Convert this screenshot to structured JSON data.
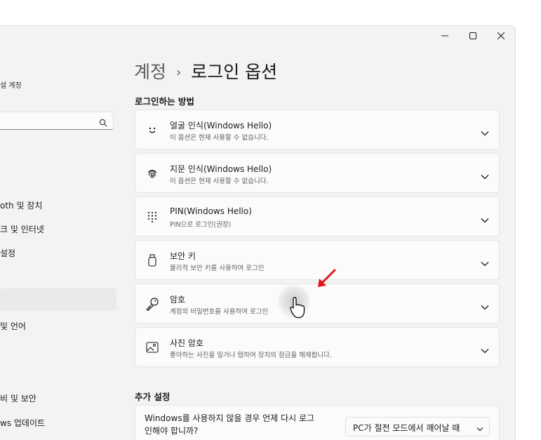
{
  "window_controls": {
    "minimize": "minimize-icon",
    "maximize": "maximize-icon",
    "close": "close-icon"
  },
  "sidebar": {
    "account_label": "설 계정",
    "search": {
      "value": "",
      "icon": "search-icon"
    },
    "items": [
      {
        "label": "oth 및 장치"
      },
      {
        "label": "크 및 인터넷"
      },
      {
        "label": "설정"
      },
      {
        "label": ""
      },
      {
        "label": "및 언어"
      },
      {
        "label": "비 및 보안"
      },
      {
        "label": "ws 업데이트"
      }
    ]
  },
  "breadcrumb": {
    "parent": "계정",
    "current": "로그인 옵션"
  },
  "section_signin": {
    "title": "로그인하는 방법"
  },
  "cards": [
    {
      "title": "얼굴 인식(Windows Hello)",
      "subtitle": "이 옵션은 현재 사용할 수 없습니다.",
      "icon": "face-icon"
    },
    {
      "title": "지문 인식(Windows Hello)",
      "subtitle": "이 옵션은 현재 사용할 수 없습니다.",
      "icon": "fingerprint-icon"
    },
    {
      "title": "PIN(Windows Hello)",
      "subtitle": "PIN으로 로그인(권장)",
      "icon": "pin-keypad-icon"
    },
    {
      "title": "보안 키",
      "subtitle": "물리적 보안 키를 사용하여 로그인",
      "icon": "usb-key-icon"
    },
    {
      "title": "암호",
      "subtitle": "계정의 비밀번호를 사용하여 로그인",
      "icon": "key-icon"
    },
    {
      "title": "사진 암호",
      "subtitle": "좋아하는 사진을 밀거나 탭하여 장치의 잠금을 해제합니다.",
      "icon": "picture-icon"
    }
  ],
  "section_additional": {
    "title": "추가 설정"
  },
  "additional": {
    "line1": "Windows를 사용하지 않을 경우 언제 다시 로그",
    "line2": "인해야 합니까?",
    "dropdown_value": "PC가 절전 모드에서 깨어날 때"
  },
  "colors": {
    "annotation_arrow": "#e8141b",
    "accent": "#005fb8"
  }
}
